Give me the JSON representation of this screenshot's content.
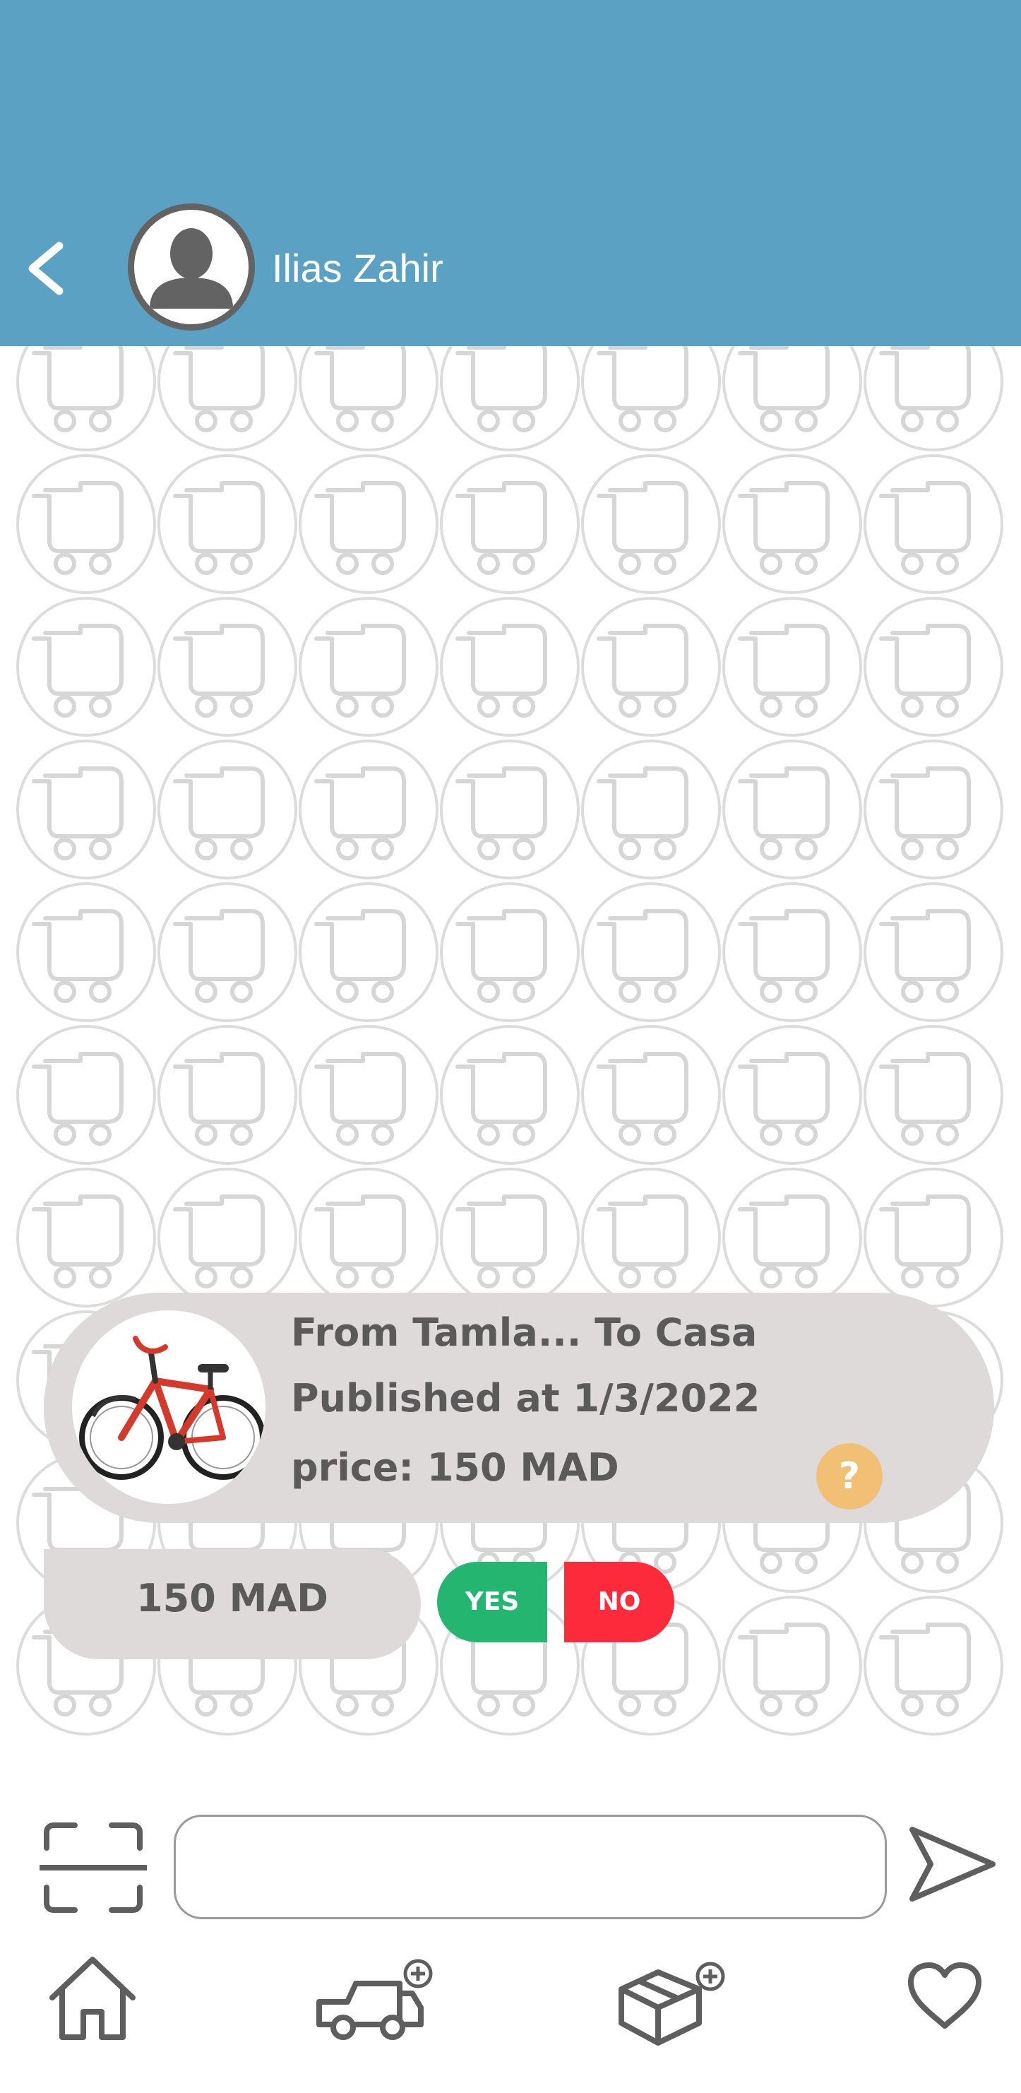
{
  "header": {
    "back_icon": "chevron-left-icon",
    "avatar_icon": "user-avatar-icon",
    "contact_name": "Ilias Zahir"
  },
  "chat": {
    "background_icon": "delivery-cart-pattern",
    "trip_card": {
      "image_icon": "bicycle-image",
      "route": "From Tamla... To Casa",
      "published": "Published at 1/3/2022",
      "price": "price: 150 MAD",
      "help_label": "?"
    },
    "offer": {
      "amount": "150 MAD",
      "yes_label": "YES",
      "no_label": "NO"
    }
  },
  "composer": {
    "scan_icon": "scan-frame-icon",
    "message_value": "",
    "message_placeholder": "",
    "send_icon": "send-icon"
  },
  "bottom_nav": {
    "items": [
      {
        "icon": "home-icon"
      },
      {
        "icon": "add-delivery-truck-icon"
      },
      {
        "icon": "add-package-icon"
      },
      {
        "icon": "favorites-heart-icon"
      }
    ]
  },
  "colors": {
    "header": "#5aa1c4",
    "bubble": "#dedad9",
    "bubble_text": "#5a5a5a",
    "yes": "#24b670",
    "no": "#fc2a3b",
    "help": "#f2c075",
    "icon_gray": "#636363",
    "pattern": "#dcdcdc"
  }
}
